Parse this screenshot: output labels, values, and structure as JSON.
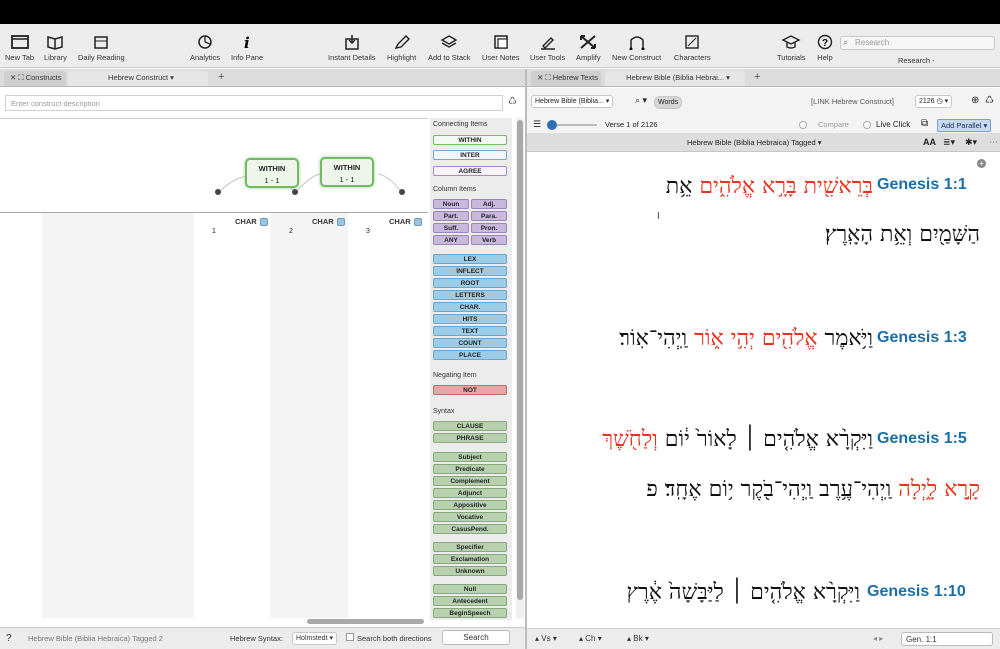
{
  "toolbar": {
    "items": [
      {
        "label": "New Tab",
        "icon": "new-tab-icon"
      },
      {
        "label": "Library",
        "icon": "library-icon"
      },
      {
        "label": "Daily Reading",
        "icon": "calendar-icon"
      },
      {
        "label": "Analytics",
        "icon": "analytics-icon"
      },
      {
        "label": "Info Pane",
        "icon": "info-icon"
      },
      {
        "label": "Instant Details",
        "icon": "instant-details-icon"
      },
      {
        "label": "Highlight",
        "icon": "highlight-pen-icon"
      },
      {
        "label": "Add to Stack",
        "icon": "stack-icon"
      },
      {
        "label": "User Notes",
        "icon": "notes-icon"
      },
      {
        "label": "User Tools",
        "icon": "user-tools-icon"
      },
      {
        "label": "Amplify",
        "icon": "amplify-icon"
      },
      {
        "label": "New Construct",
        "icon": "construct-icon"
      },
      {
        "label": "Characters",
        "icon": "characters-icon"
      },
      {
        "label": "Tutorials",
        "icon": "graduation-cap-icon"
      },
      {
        "label": "Help",
        "icon": "help-icon"
      }
    ],
    "search_placeholder": "Research",
    "research_label": "Research -"
  },
  "left": {
    "tab_constructs": "Constructs",
    "tab_main": "Hebrew Construct",
    "desc_placeholder": "Enter construct description",
    "within_label": "WITHIN",
    "within_range": "1 - 1",
    "char_label": "CHAR",
    "col_numbers": [
      "1",
      "2",
      "3"
    ],
    "palette": {
      "connecting_title": "Connecting Items",
      "connecting": [
        "WITHIN",
        "INTER",
        "AGREE"
      ],
      "column_title": "Column Items",
      "column_pairs": [
        [
          "Noun",
          "Adj."
        ],
        [
          "Part.",
          "Para."
        ],
        [
          "Suff.",
          "Pron."
        ],
        [
          "ANY",
          "Verb"
        ]
      ],
      "column_blue": [
        "LEX",
        "INFLECT",
        "ROOT",
        "LETTERS",
        "CHAR.",
        "HITS",
        "TEXT",
        "COUNT",
        "PLACE"
      ],
      "negating_title": "Negating Item",
      "negating": [
        "NOT"
      ],
      "syntax_title": "Syntax",
      "syntax_a": [
        "CLAUSE",
        "PHRASE"
      ],
      "syntax_b": [
        "Subject",
        "Predicate",
        "Complement",
        "Adjunct",
        "Appositive",
        "Vocative",
        "CasusPend."
      ],
      "syntax_c": [
        "Specifier",
        "Exclamation",
        "Unknown"
      ],
      "syntax_d": [
        "Null",
        "Antecedent",
        "BeginSpeech"
      ]
    },
    "status": {
      "module": "Hebrew Bible (Biblia Hebraica) Tagged 2",
      "syntax_label": "Hebrew Syntax:",
      "syntax_value": "Holmstedt",
      "both_label": "Search both directions",
      "search_button": "Search"
    }
  },
  "right": {
    "tab_texts": "Hebrew Texts",
    "tab_main": "Hebrew Bible (Biblia Hebrai...",
    "module_select": "Hebrew Bible (Biblia...",
    "search_mode": "Words",
    "link_label": "[LINK Hebrew Construct]",
    "count": "2126",
    "verse_counter": "Verse 1 of 2126",
    "compare_label": "Compare",
    "liveclick_label": "Live Click",
    "add_parallel": "Add Parallel",
    "header_title": "Hebrew Bible (Biblia Hebraica) Tagged",
    "verses": [
      {
        "ref": "Genesis 1:1",
        "line1": "בְּרֵאשִׁ֖ית בָּרָ֣א אֱלֹהִ֑ים אֵ֥ת",
        "line2": "הַשָּׁמַ֖יִם וְאֵ֥ת הָאָֽרֶץ׃"
      },
      {
        "ref": "Genesis 1:3",
        "line1": "וַיֹּ֥אמֶר אֱלֹהִ֖ים יְהִ֣י א֑וֹר וַֽיְהִי־אֽוֹר׃"
      },
      {
        "ref": "Genesis 1:5",
        "line1": "וַיִּקְרָ֨א אֱלֹהִ֤ים ׀ לָאוֹר֙ י֔וֹם וְלַחֹ֖שֶׁךְ",
        "line2": "קָ֣רָא לָ֑יְלָה וַֽיְהִי־עֶ֥רֶב וַֽיְהִי־בֹ֖קֶר י֥וֹם אֶחָֽד׃ פ"
      },
      {
        "ref": "Genesis 1:10",
        "line1": "וַיִּקְרָ֨א אֱלֹהִ֤ים ׀ לַיַּבָּשָׁה֙ אֶ֔רֶץ"
      }
    ],
    "status": {
      "vs": "Vs",
      "ch": "Ch",
      "bk": "Bk",
      "goto": "Gen. 1:1"
    }
  }
}
